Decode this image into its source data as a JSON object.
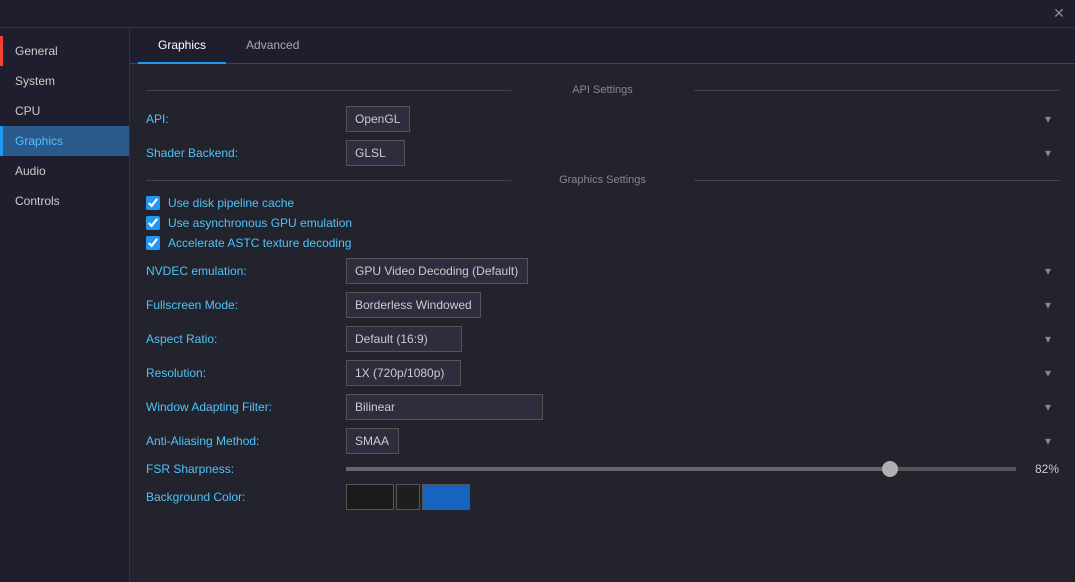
{
  "window": {
    "close_label": "✕"
  },
  "sidebar": {
    "items": [
      {
        "id": "general",
        "label": "General",
        "active": false,
        "indicator": false
      },
      {
        "id": "system",
        "label": "System",
        "active": false,
        "indicator": false
      },
      {
        "id": "cpu",
        "label": "CPU",
        "active": false,
        "indicator": false
      },
      {
        "id": "graphics",
        "label": "Graphics",
        "active": true,
        "indicator": false
      },
      {
        "id": "audio",
        "label": "Audio",
        "active": false,
        "indicator": false
      },
      {
        "id": "controls",
        "label": "Controls",
        "active": false,
        "indicator": false
      }
    ]
  },
  "tabs": [
    {
      "id": "graphics",
      "label": "Graphics",
      "active": true
    },
    {
      "id": "advanced",
      "label": "Advanced",
      "active": false
    }
  ],
  "api_section": {
    "header": "API Settings",
    "api_label": "API:",
    "api_value": "OpenGL",
    "shader_label": "Shader Backend:",
    "shader_value": "GLSL"
  },
  "graphics_section": {
    "header": "Graphics Settings",
    "checkboxes": [
      {
        "id": "disk_pipeline",
        "label": "Use disk pipeline cache",
        "checked": true
      },
      {
        "id": "async_gpu",
        "label": "Use asynchronous GPU emulation",
        "checked": true
      },
      {
        "id": "astc",
        "label": "Accelerate ASTC texture decoding",
        "checked": true
      }
    ],
    "dropdowns": [
      {
        "id": "nvdec",
        "label": "NVDEC emulation:",
        "value": "GPU Video Decoding (Default)"
      },
      {
        "id": "fullscreen",
        "label": "Fullscreen Mode:",
        "value": "Borderless Windowed"
      },
      {
        "id": "aspect_ratio",
        "label": "Aspect Ratio:",
        "value": "Default (16:9)"
      },
      {
        "id": "resolution",
        "label": "Resolution:",
        "value": "1X (720p/1080p)"
      },
      {
        "id": "window_filter",
        "label": "Window Adapting Filter:",
        "value": "Bilinear"
      },
      {
        "id": "anti_aliasing",
        "label": "Anti-Aliasing Method:",
        "value": "SMAA"
      }
    ],
    "fsr_label": "FSR Sharpness:",
    "fsr_value": 82,
    "fsr_display": "82%",
    "bg_color_label": "Background Color:"
  }
}
